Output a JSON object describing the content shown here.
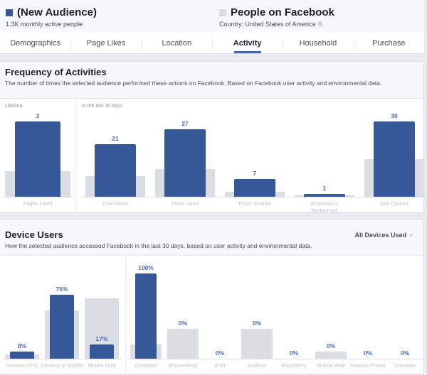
{
  "header": {
    "audience_a": {
      "name": "(New Audience)",
      "subtitle": "1.3K monthly active people",
      "color": "#365899"
    },
    "audience_b": {
      "name": "People on Facebook",
      "subtitle": "Country: United States of America",
      "color": "#dadde1",
      "info_icon": "i"
    }
  },
  "tabs": [
    {
      "label": "Demographics",
      "active": false
    },
    {
      "label": "Page Likes",
      "active": false
    },
    {
      "label": "Location",
      "active": false
    },
    {
      "label": "Activity",
      "active": true
    },
    {
      "label": "Household",
      "active": false
    },
    {
      "label": "Purchase",
      "active": false
    }
  ],
  "frequency": {
    "title": "Frequency of Activities",
    "description": "The number of times the selected audience performed these actions on Facebook. Based on Facebook user activity and environmental data.",
    "lifetime_label": "Lifetime",
    "last30_label": "In the last 30 days"
  },
  "devices": {
    "title": "Device Users",
    "description": "How the selected audience accessed Facebook in the last 30 days, based on user activity and environmental data.",
    "dropdown_label": "All Devices Used",
    "dropdown_caret": "▼"
  },
  "chart_data": [
    {
      "type": "bar",
      "title": "Frequency of Activities — Lifetime",
      "categories": [
        "Pages Liked"
      ],
      "series": [
        {
          "name": "(New Audience)",
          "values": [
            3
          ],
          "labels": [
            "3"
          ]
        },
        {
          "name": "People on Facebook",
          "relative": [
            0.34
          ]
        }
      ]
    },
    {
      "type": "bar",
      "title": "Frequency of Activities — In the last 30 days",
      "categories": [
        "Comments",
        "Posts Liked",
        "Posts Shared",
        "Promotions Redeemed",
        "Ads Clicked"
      ],
      "series": [
        {
          "name": "(New Audience)",
          "values": [
            21,
            27,
            7,
            1,
            30
          ],
          "labels": [
            "21",
            "27",
            "7",
            "1",
            "30"
          ]
        },
        {
          "name": "People on Facebook",
          "relative": [
            0.27,
            0.37,
            0.07,
            0.02,
            0.5
          ]
        }
      ]
    },
    {
      "type": "bar",
      "title": "Device Users — Platform",
      "categories": [
        "Desktop Only",
        "Desktop & Mobile",
        "Mobile Only"
      ],
      "series": [
        {
          "name": "(New Audience)",
          "values": [
            8,
            75,
            17
          ],
          "labels": [
            "8%",
            "75%",
            "17%"
          ]
        },
        {
          "name": "People on Facebook",
          "values": [
            5,
            57,
            71
          ]
        }
      ],
      "ylim": [
        0,
        100
      ]
    },
    {
      "type": "bar",
      "title": "Device Users — Device",
      "categories": [
        "Computer",
        "iPhone/iPod",
        "iPad",
        "Android",
        "Blackberry",
        "Mobile Web",
        "Feature Phone",
        "Unknown"
      ],
      "series": [
        {
          "name": "(New Audience)",
          "values": [
            100,
            0,
            0,
            0,
            0,
            0,
            0,
            0
          ],
          "labels": [
            "100%",
            "0%",
            "0%",
            "0%",
            "0%",
            "0%",
            "0%",
            "0%"
          ]
        },
        {
          "name": "People on Facebook",
          "values": [
            17,
            35,
            0,
            35,
            0,
            8,
            0,
            0
          ]
        }
      ],
      "ylim": [
        0,
        100
      ]
    }
  ]
}
